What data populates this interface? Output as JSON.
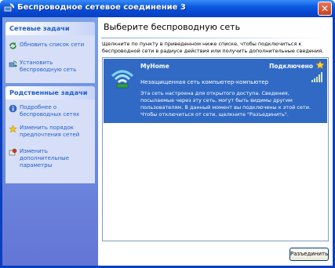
{
  "window": {
    "title": "Беспроводное сетевое соединение 3"
  },
  "left": {
    "network_tasks": {
      "header": "Сетевые задачи",
      "items": [
        {
          "icon": "refresh-icon",
          "label": "Обновить список сети"
        },
        {
          "icon": "setup-wireless-icon",
          "label": "Установить беспроводную сеть"
        }
      ]
    },
    "related_tasks": {
      "header": "Родственные задачи",
      "items": [
        {
          "icon": "info-icon",
          "label": "Подробнее о беспроводных сетях"
        },
        {
          "icon": "star-order-icon",
          "label": "Изменить порядок предпочтения сетей"
        },
        {
          "icon": "settings-icon",
          "label": "Изменить дополнительные параметры"
        }
      ]
    }
  },
  "main": {
    "heading": "Выберите беспроводную сеть",
    "instructions": "Щелкните по пункту в приведенном ниже списке, чтобы подключиться к беспроводной сети в радиусе действия или получить дополнительные сведения.",
    "networks": [
      {
        "name": "MyHome",
        "status": "Подключено",
        "type": "Незащищенная сеть компьютер-компьютер",
        "description": "Эта сеть настроена для открытого доступа. Сведения, посылаемые через эту сеть, могут быть видимы другим пользователям. В данный момент вы подключены к этой сети. Чтобы отключиться от сети, щелкните \"Разъединить\".",
        "signal_bars": 5
      }
    ],
    "disconnect_label": "Разъединить"
  },
  "colors": {
    "titlebar": "#0a5ae0",
    "selected_item": "#316ac5",
    "task_link": "#215dc6",
    "left_pane": "#6f8ddd"
  }
}
